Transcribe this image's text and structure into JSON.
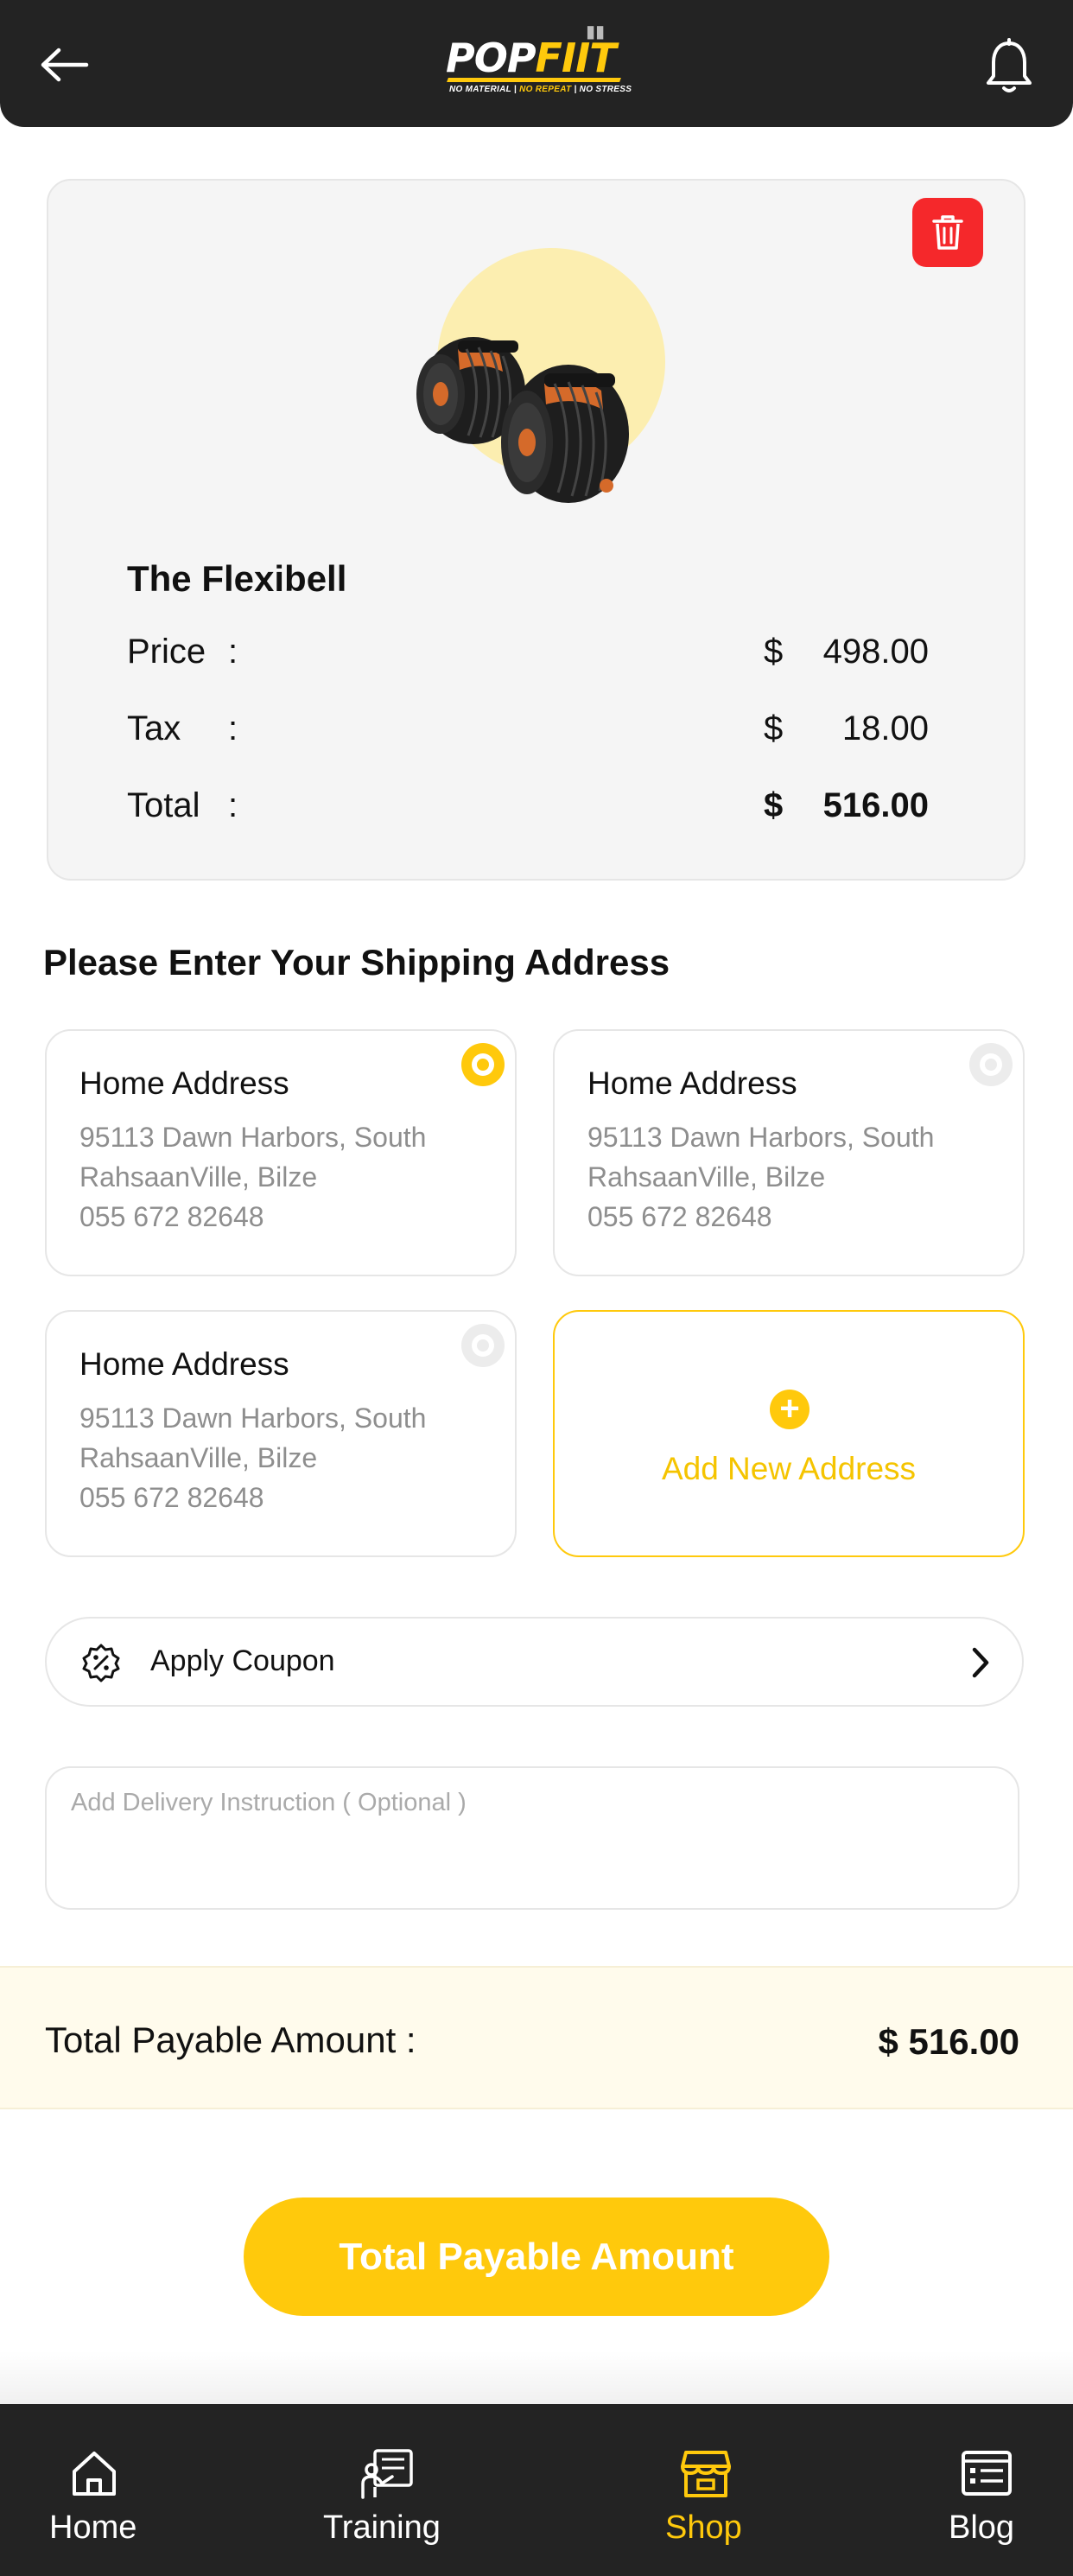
{
  "header": {
    "logo_pop": "POP",
    "logo_fiit": "FIIT",
    "logo_tagline_1": "NO MATERIAL",
    "logo_tagline_2": "NO REPEAT",
    "logo_tagline_3": "NO STRESS"
  },
  "product": {
    "name": "The Flexibell",
    "price_label": "Price",
    "tax_label": "Tax",
    "total_label": "Total",
    "colon": ":",
    "currency": "$",
    "price": "498.00",
    "tax": "18.00",
    "total": "516.00"
  },
  "shipping": {
    "title": "Please Enter Your Shipping Address",
    "addresses": [
      {
        "title": "Home Address",
        "line1": "95113 Dawn Harbors, South",
        "line2": "RahsaanVille, Bilze",
        "phone": "055 672 82648",
        "selected": true
      },
      {
        "title": "Home Address",
        "line1": "95113 Dawn Harbors, South",
        "line2": "RahsaanVille, Bilze",
        "phone": "055 672 82648",
        "selected": false
      },
      {
        "title": "Home Address",
        "line1": "95113 Dawn Harbors, South",
        "line2": "RahsaanVille, Bilze",
        "phone": "055 672 82648",
        "selected": false
      }
    ],
    "add_new_label": "Add New Address"
  },
  "coupon": {
    "label": "Apply Coupon"
  },
  "instruction": {
    "placeholder": "Add Delivery Instruction ( Optional )",
    "value": ""
  },
  "summary": {
    "total_label": "Total Payable Amount  :",
    "total_value": "$ 516.00"
  },
  "pay_button": {
    "label": "Total Payable Amount"
  },
  "bottom_nav": {
    "items": [
      {
        "label": "Home",
        "icon": "home-icon"
      },
      {
        "label": "Training",
        "icon": "training-icon"
      },
      {
        "label": "Shop",
        "icon": "shop-icon",
        "active": true
      },
      {
        "label": "Blog",
        "icon": "blog-icon"
      }
    ]
  },
  "colors": {
    "accent": "#FFC90C",
    "dark": "#232323",
    "delete": "#F5282B"
  }
}
